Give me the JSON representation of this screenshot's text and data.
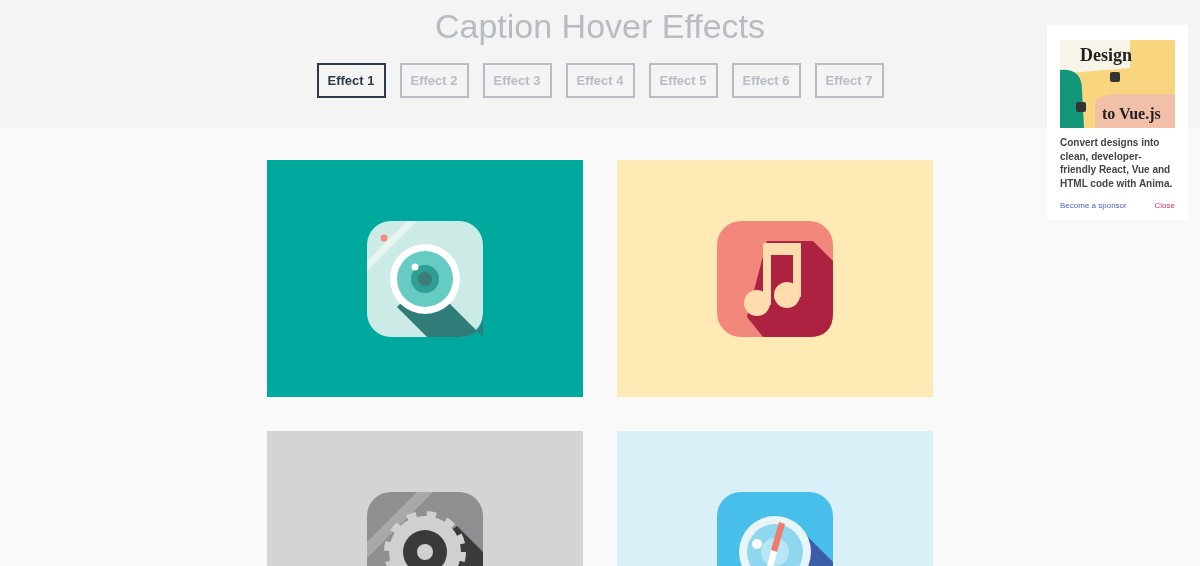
{
  "title": "Caption Hover Effects",
  "tabs": [
    {
      "label": "Effect 1",
      "selected": true
    },
    {
      "label": "Effect 2",
      "selected": false
    },
    {
      "label": "Effect 3",
      "selected": false
    },
    {
      "label": "Effect 4",
      "selected": false
    },
    {
      "label": "Effect 5",
      "selected": false
    },
    {
      "label": "Effect 6",
      "selected": false
    },
    {
      "label": "Effect 7",
      "selected": false
    }
  ],
  "tiles": [
    {
      "kind": "camera",
      "color": "#00a99d"
    },
    {
      "kind": "music",
      "color": "#ffeab5"
    },
    {
      "kind": "gear",
      "color": "#d3d4d6"
    },
    {
      "kind": "compass",
      "color": "#d9f0f8"
    }
  ],
  "sponsor": {
    "banner_top": "Design",
    "banner_bottom": "to Vue.js",
    "text": "Convert designs into clean, developer-friendly React, Vue and HTML code with Anima.",
    "link": "Become a sponsor",
    "close": "Close"
  }
}
